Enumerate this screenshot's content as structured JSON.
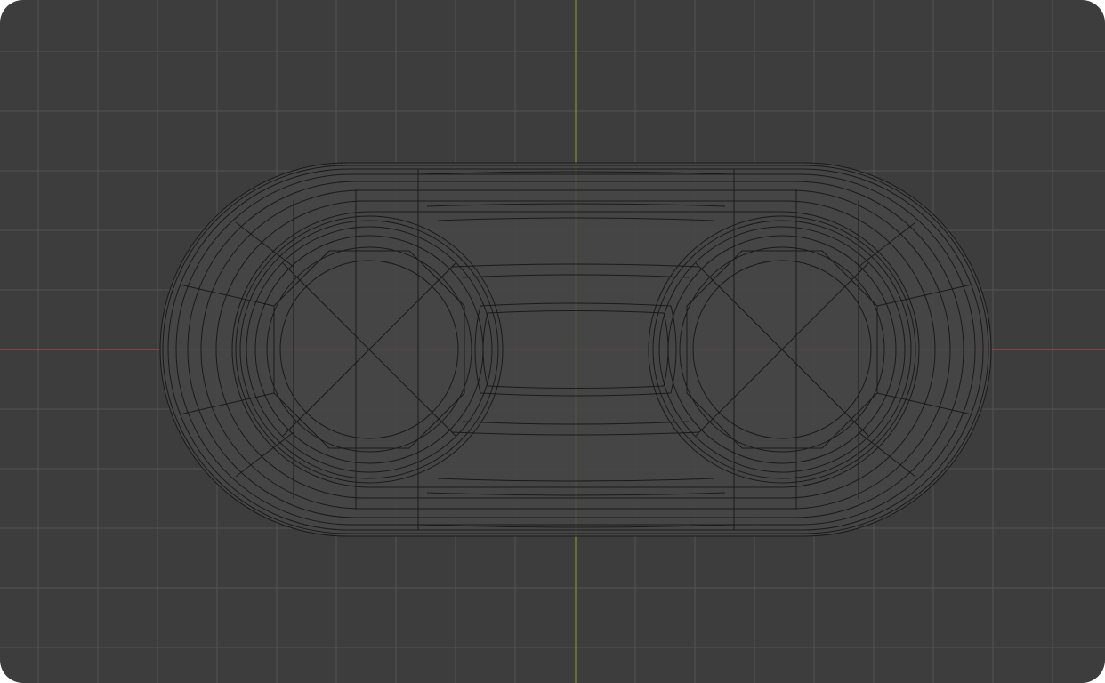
{
  "viewport": {
    "mode": "wireframe",
    "view": "top-orthographic",
    "colors": {
      "background": "#3d3d3d",
      "grid": "#545454",
      "x_axis": "#b8434b",
      "y_axis": "#7a9a2c",
      "wire": "#1a1a1a",
      "mesh_fill": "#474747"
    },
    "object": {
      "name": "",
      "shape": "stadium-tray-with-two-circular-wells"
    }
  }
}
